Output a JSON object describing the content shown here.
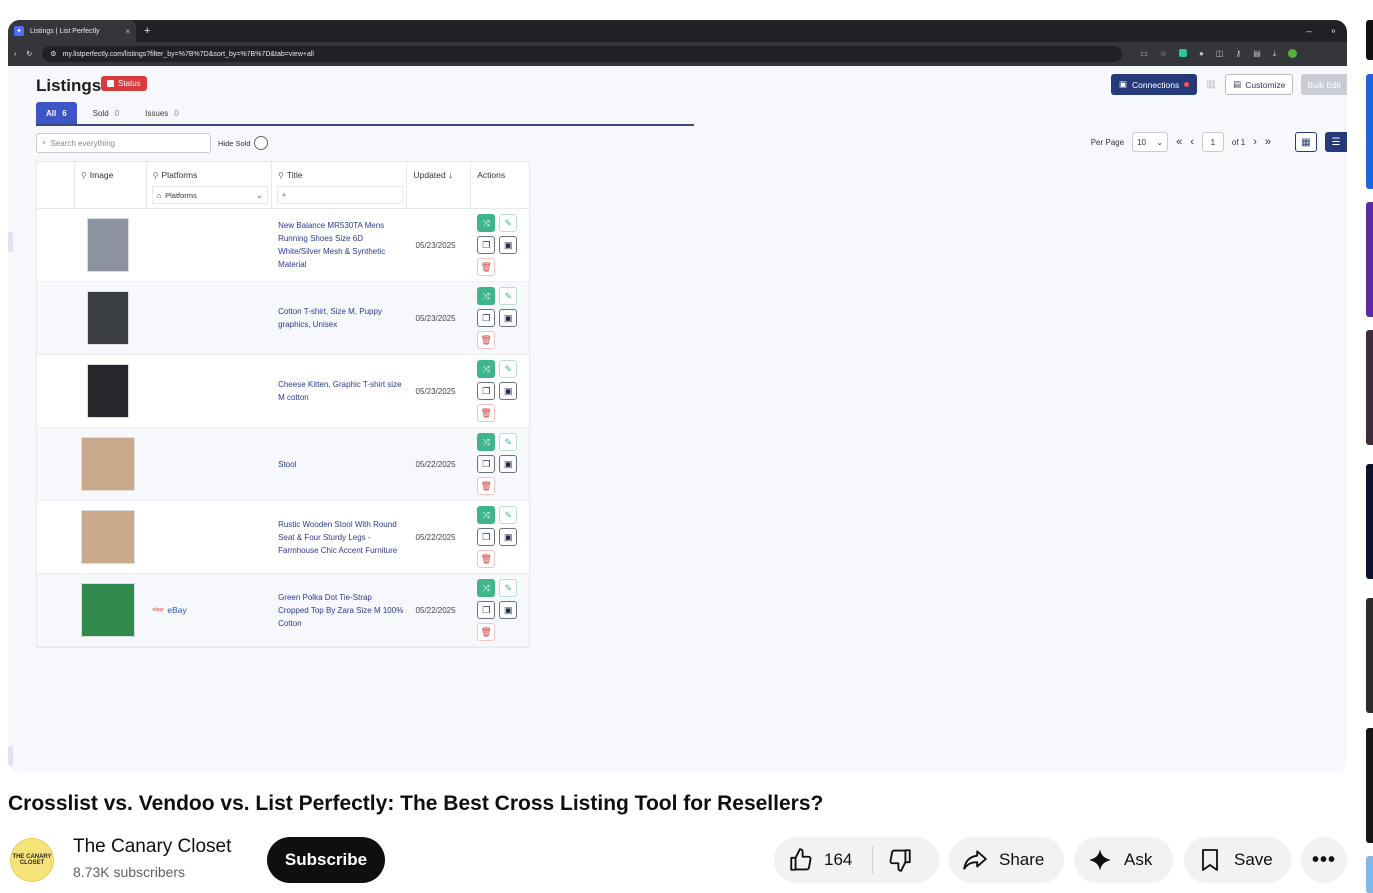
{
  "browser": {
    "tab_title": "Listings | List Perfectly",
    "tab_close": "×",
    "new_tab": "+",
    "url": "my.listperfectly.com/listings?filter_by=%7B%7D&sort_by=%7B%7D&tab=view+all"
  },
  "app": {
    "page_title": "Listings",
    "status_label": "Status",
    "tabs": [
      {
        "label": "All",
        "count": "6"
      },
      {
        "label": "Sold",
        "count": "0"
      },
      {
        "label": "Issues",
        "count": "0"
      }
    ],
    "search_placeholder": "Search everything",
    "hide_sold_label": "Hide Sold",
    "connections_label": "Connections",
    "customize_label": "Customize",
    "bulk_edit_label": "Bulk Edit",
    "per_page_label": "Per Page",
    "per_page_value": "10",
    "page_current": "1",
    "page_of": "of 1",
    "columns": {
      "image": "Image",
      "platforms": "Platforms",
      "platforms_filter": "Platforms",
      "title": "Title",
      "updated": "Updated",
      "actions": "Actions"
    },
    "rows": [
      {
        "title": "New Balance MR530TA Mens Running Shoes Size 6D White/Silver Mesh & Synthetic Material",
        "updated": "05/23/2025",
        "platform": "",
        "thumb_color": "#8c93a0",
        "wide": false
      },
      {
        "title": "Cotton T-shirt, Size M, Puppy graphics, Unisex",
        "updated": "05/23/2025",
        "platform": "",
        "thumb_color": "#3a3d42",
        "wide": false
      },
      {
        "title": "Cheese Kitten, Graphic T-shirt size M cotton",
        "updated": "05/23/2025",
        "platform": "",
        "thumb_color": "#26282c",
        "wide": false
      },
      {
        "title": "Stool",
        "updated": "05/22/2025",
        "platform": "",
        "thumb_color": "#c9a98a",
        "wide": true
      },
      {
        "title": "Rustic Wooden Stool With Round Seat & Four Sturdy Legs - Farmhouse Chic Accent Furniture",
        "updated": "05/22/2025",
        "platform": "",
        "thumb_color": "#c9a98a",
        "wide": true
      },
      {
        "title": "Green Polka Dot Tie-Strap Cropped Top By Zara Size M 100% Cotton",
        "updated": "05/22/2025",
        "platform": "eBay",
        "thumb_color": "#2f8a4c",
        "wide": true
      }
    ]
  },
  "video": {
    "title": "Crosslist vs. Vendoo vs. List Perfectly: The Best Cross Listing Tool for Resellers?",
    "channel_name": "The Canary Closet",
    "avatar_text": "THE CANARY CLOSET",
    "subscribers": "8.73K subscribers",
    "subscribe_label": "Subscribe",
    "likes": "164",
    "share_label": "Share",
    "ask_label": "Ask",
    "save_label": "Save",
    "more_label": "•••"
  },
  "colors": {
    "brand_navy": "#263a7a",
    "tab_blue": "#3e55c5",
    "status_red": "#d83b3b",
    "action_green": "#3fb58c"
  }
}
